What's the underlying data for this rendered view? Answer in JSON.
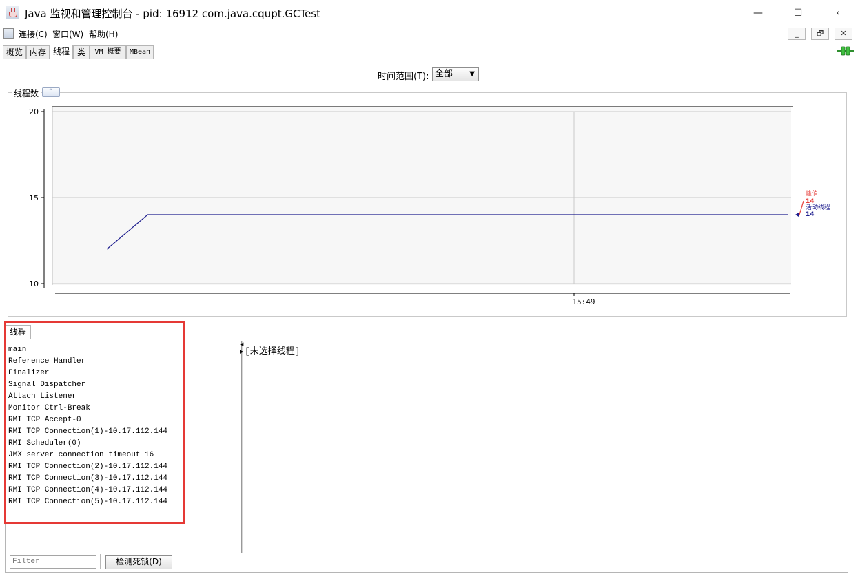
{
  "window": {
    "title": "Java 监视和管理控制台 - pid: 16912 com.java.cqupt.GCTest",
    "controls": {
      "minimize": "—",
      "maximize": "☐",
      "back": "‹"
    }
  },
  "menu": {
    "items": [
      "连接(C)",
      "窗口(W)",
      "帮助(H)"
    ],
    "mdi": {
      "minimize": "_",
      "restore": "🗗",
      "close": "✕"
    }
  },
  "tabs": [
    "概览",
    "内存",
    "线程",
    "类",
    "VM 概要",
    "MBean"
  ],
  "active_tab": "线程",
  "range": {
    "label": "时间范围(T):",
    "value": "全部"
  },
  "chart_panel": {
    "title": "线程数",
    "collapse": "⌃"
  },
  "chart_data": {
    "type": "line",
    "y_ticks": [
      "20",
      "15",
      "10"
    ],
    "ylim": [
      10,
      20
    ],
    "x_ticks": [
      "15:49"
    ],
    "series": [
      {
        "name": "活动线程",
        "color": "#1f1f8f",
        "points": [
          [
            0,
            12
          ],
          [
            0.06,
            14
          ],
          [
            1,
            14
          ]
        ]
      }
    ],
    "legend": [
      {
        "label": "峰值",
        "value": "14",
        "color": "#e53935"
      },
      {
        "label": "活动线程",
        "value": "14",
        "color": "#1f1f8f"
      }
    ]
  },
  "threads": {
    "tab_label": "线程",
    "list": [
      "main",
      "Reference Handler",
      "Finalizer",
      "Signal Dispatcher",
      "Attach Listener",
      "Monitor Ctrl-Break",
      "RMI TCP Accept-0",
      "RMI TCP Connection(1)-10.17.112.144",
      "RMI Scheduler(0)",
      "JMX server connection timeout 16",
      "RMI TCP Connection(2)-10.17.112.144",
      "RMI TCP Connection(3)-10.17.112.144",
      "RMI TCP Connection(4)-10.17.112.144",
      "RMI TCP Connection(5)-10.17.112.144"
    ],
    "detail": "[未选择线程]",
    "filter_placeholder": "Filter",
    "detect_deadlock": "检测死锁(D)"
  },
  "colors": {
    "highlight": "#e53935",
    "plot_bg": "#f7f7f7",
    "grid": "#c8c8c8"
  }
}
